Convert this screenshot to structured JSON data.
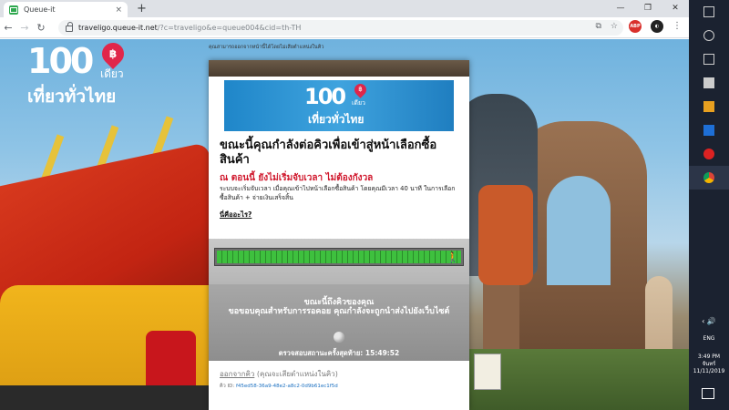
{
  "browser": {
    "tab_title": "Queue-it",
    "tab_close": "×",
    "new_tab": "+",
    "window_controls": [
      "—",
      "❐",
      "✕"
    ],
    "url_host": "traveligo.queue-it.net",
    "url_path": "/?c=traveligo&e=queue004&cid=th-TH",
    "ext_abp": "ABP"
  },
  "logo": {
    "number": "100",
    "baht": "฿",
    "sub": "เดียว",
    "tagline": "เที่ยวทั่วไทย"
  },
  "page": {
    "top_note": "คุณสามารถออกจากหน้านี้ได้โดยไม่เสียตำแหน่งในคิว"
  },
  "card": {
    "heading": "ขณะนี้คุณกำลังต่อคิวเพื่อเข้าสู่หน้าเลือกซื้อสินค้า",
    "warning": "ณ ตอนนี้ ยังไม่เริ่มจับเวลา ไม่ต้องกังวล",
    "description": "ระบบจะเริ่มจับเวลา เมื่อคุณเข้าไปหน้าเลือกซื้อสินค้า โดยคุณมีเวลา 40 นาที ในการเลือกซื้อสินค้า + จ่ายเงินเสร็จสิ้น",
    "what_link": "นี่คืออะไร?",
    "progress_fraction": 1.0,
    "status_title": "ขณะนี้ถึงคิวของคุณ",
    "status_message": "ขอขอบคุณสำหรับการรอคอย คุณกำลังจะถูกนำส่งไปยังเว็บไซต์",
    "last_checked_label": "ตรวจสอบสถานะครั้งสุดท้าย:",
    "last_checked_time": "15:49:52",
    "leave_link": "ออกจากคิว",
    "leave_note": "(คุณจะเสียตำแหน่งในคิว)",
    "queue_id_label": "คิว ID:",
    "queue_id": "f45ed58-36a9-48e2-a8c2-0d9b61ec1f5d"
  },
  "taskbar": {
    "tray": "‹ 🔊",
    "lang": "ENG",
    "time": "3:49 PM",
    "day": "จันทร์",
    "date": "11/11/2019"
  },
  "colors": {
    "accent_blue": "#1f86c9",
    "warning_red": "#d0182d",
    "progress_green": "#3ec03e"
  }
}
